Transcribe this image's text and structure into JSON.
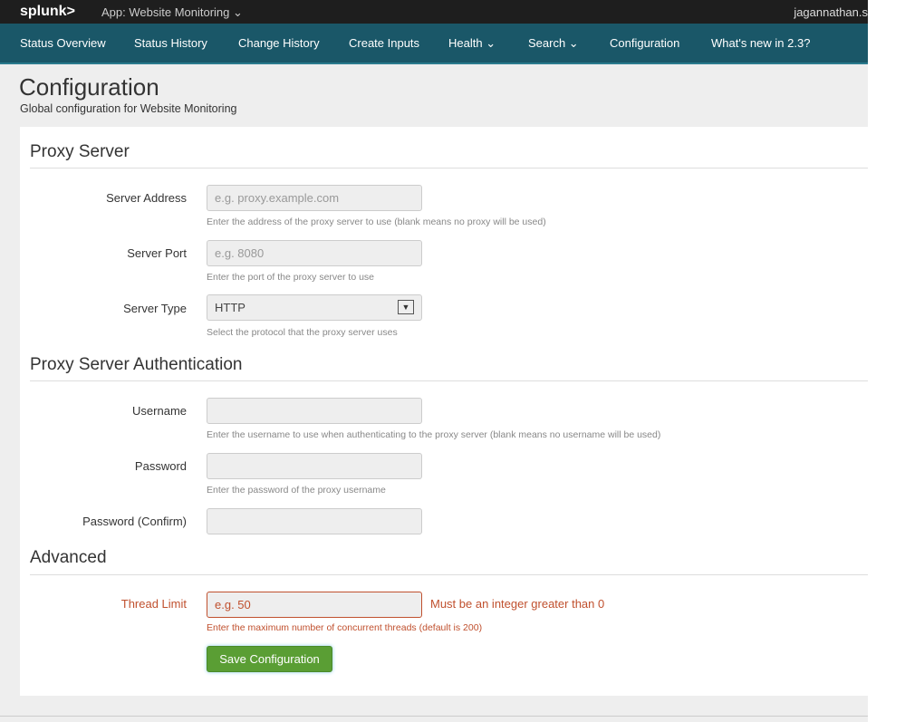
{
  "topbar": {
    "logo": "splunk>",
    "app": "App: Website Monitoring ⌄",
    "user": "jagannathan.s"
  },
  "nav": [
    "Status Overview",
    "Status History",
    "Change History",
    "Create Inputs",
    "Health ⌄",
    "Search ⌄",
    "Configuration",
    "What's new in 2.3?"
  ],
  "page": {
    "title": "Configuration",
    "subtitle": "Global configuration for Website Monitoring"
  },
  "sections": {
    "proxy": "Proxy Server",
    "auth": "Proxy Server Authentication",
    "advanced": "Advanced"
  },
  "fields": {
    "server_address": {
      "label": "Server Address",
      "placeholder": "e.g. proxy.example.com",
      "help": "Enter the address of the proxy server to use (blank means no proxy will be used)"
    },
    "server_port": {
      "label": "Server Port",
      "placeholder": "e.g. 8080",
      "help": "Enter the port of the proxy server to use"
    },
    "server_type": {
      "label": "Server Type",
      "value": "HTTP",
      "help": "Select the protocol that the proxy server uses"
    },
    "username": {
      "label": "Username",
      "help": "Enter the username to use when authenticating to the proxy server (blank means no username will be used)"
    },
    "password": {
      "label": "Password",
      "help": "Enter the password of the proxy username"
    },
    "password_confirm": {
      "label": "Password (Confirm)"
    },
    "thread_limit": {
      "label": "Thread Limit",
      "placeholder": "e.g. 50",
      "error": "Must be an integer greater than 0",
      "help": "Enter the maximum number of concurrent threads (default is 200)"
    }
  },
  "save_label": "Save Configuration",
  "colors": {
    "nav": "#1a5768",
    "error": "#c0502e",
    "save": "#5a9e34"
  }
}
